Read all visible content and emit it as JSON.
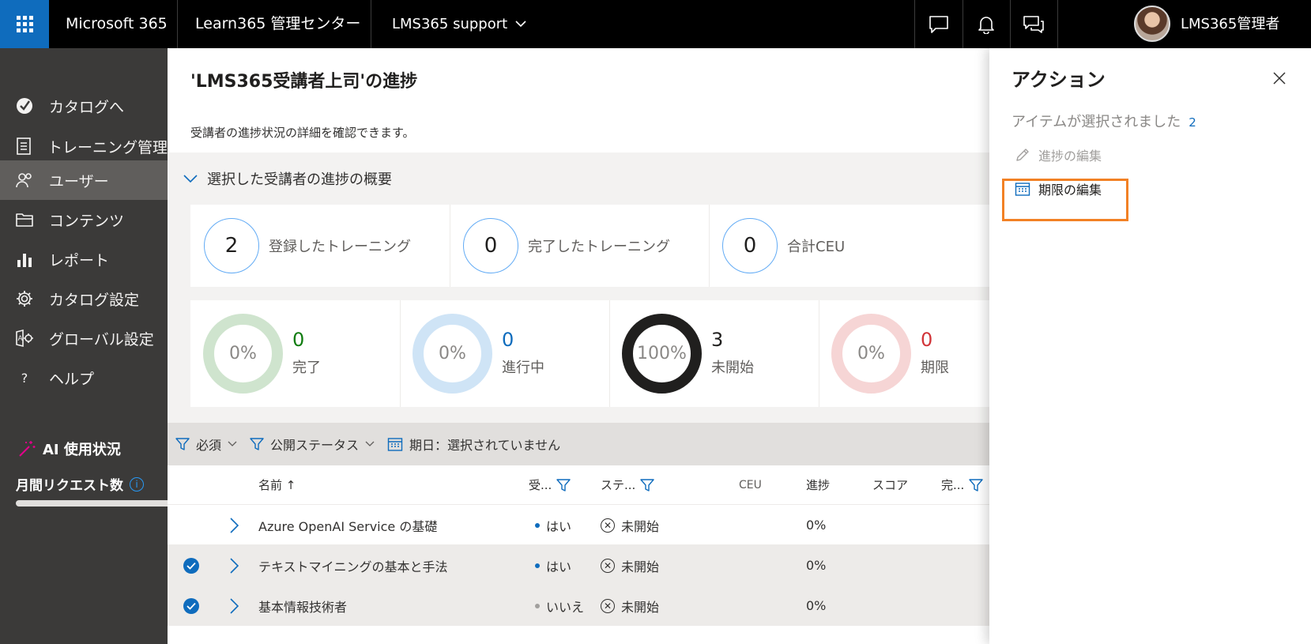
{
  "topbar": {
    "suite": "Microsoft 365",
    "app": "Learn365 管理センター",
    "tenant": "LMS365 support",
    "user": "LMS365管理者",
    "icons": [
      "chat-icon",
      "bell-icon",
      "feedback-icon"
    ]
  },
  "sidebar": {
    "items": [
      {
        "label": "カタログへ",
        "icon": "catalog-check-icon"
      },
      {
        "label": "トレーニング管理",
        "icon": "training-icon"
      },
      {
        "label": "ユーザー",
        "icon": "users-icon",
        "selected": true
      },
      {
        "label": "コンテンツ",
        "icon": "folder-icon"
      },
      {
        "label": "レポート",
        "icon": "chart-icon"
      },
      {
        "label": "カタログ設定",
        "icon": "gear-icon"
      },
      {
        "label": "グローバル設定",
        "icon": "global-settings-icon"
      },
      {
        "label": "ヘルプ",
        "icon": "help-icon"
      }
    ],
    "ai_title": "AI 使用状況",
    "monthly_requests": "月間リクエスト数",
    "monthly_requests_progress": 1.0
  },
  "main": {
    "title": "'LMS365受講者上司'の進捗",
    "description": "受講者の進捗状況の詳細を確認できます。",
    "summary_title": "選択した受講者の進捗の概要",
    "stats": [
      {
        "value": "2",
        "label": "登録したトレーニング"
      },
      {
        "value": "0",
        "label": "完了したトレーニング"
      },
      {
        "value": "0",
        "label": "合計CEU"
      }
    ],
    "donuts": [
      {
        "percent": "0%",
        "count": "0",
        "label": "完了",
        "color": "#107c10",
        "ring": "#cfe4ce",
        "fill": 0
      },
      {
        "percent": "0%",
        "count": "0",
        "label": "進行中",
        "color": "#0f6cbd",
        "ring": "#cfe4f6",
        "fill": 0
      },
      {
        "percent": "100%",
        "count": "3",
        "label": "未開始",
        "color": "#201f1e",
        "ring": "#201f1e",
        "fill": 1
      },
      {
        "percent": "0%",
        "count": "0",
        "label": "期限",
        "color": "#d13438",
        "ring": "#f6d5d5",
        "fill": 0
      }
    ],
    "filters": {
      "required": "必須",
      "publish_status": "公開ステータス",
      "due_date": "期日：選択されていません"
    },
    "table": {
      "columns": {
        "name": "名前 ↑",
        "enrolled": "受...",
        "status": "ステ...",
        "ceu": "CEU",
        "progress": "進捗",
        "score": "スコア",
        "completed": "完..."
      },
      "rows": [
        {
          "name": "Azure OpenAI Service の基礎",
          "enrolled": "はい",
          "status": "未開始",
          "progress": "0%",
          "selected": false
        },
        {
          "name": "テキストマイニングの基本と手法",
          "enrolled": "はい",
          "status": "未開始",
          "progress": "0%",
          "selected": true
        },
        {
          "name": "基本情報技術者",
          "enrolled": "いいえ",
          "status": "未開始",
          "progress": "0%",
          "selected": true
        }
      ]
    }
  },
  "panel": {
    "title": "アクション",
    "selected_text": "アイテムが選択されました",
    "selected_count": "2",
    "actions": [
      {
        "label": "進捗の編集",
        "icon": "pencil-icon",
        "enabled": false
      },
      {
        "label": "期限の編集",
        "icon": "calendar-icon",
        "enabled": true
      }
    ]
  },
  "colors": {
    "accent": "#0f6cbd",
    "highlight": "#f28125",
    "sidebar": "#3b3a39"
  }
}
